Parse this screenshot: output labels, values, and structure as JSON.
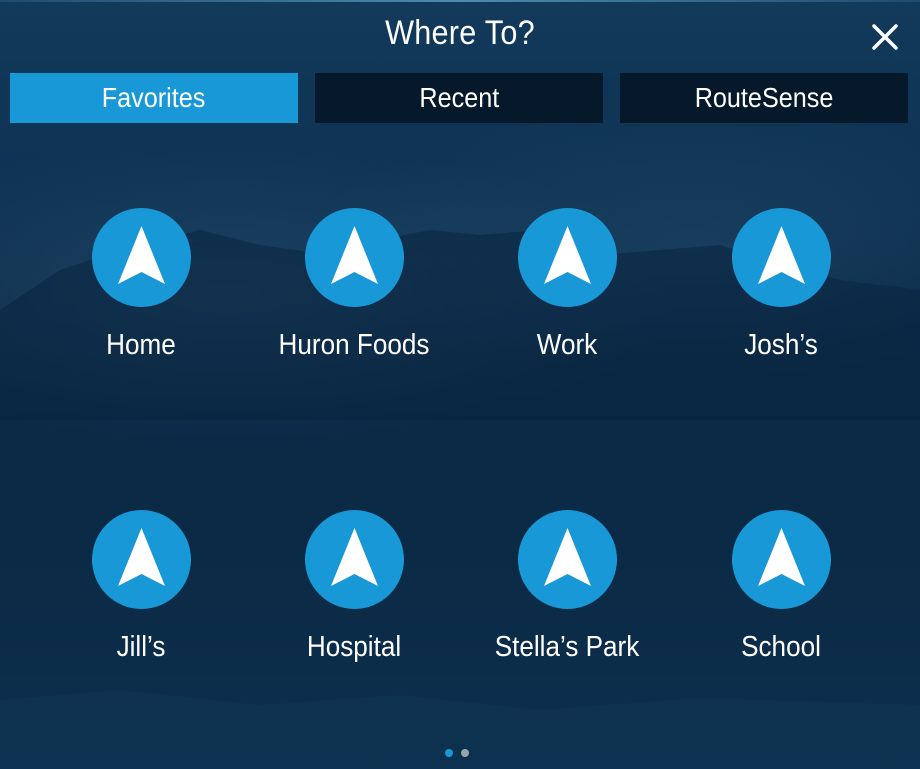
{
  "header": {
    "title": "Where To?",
    "close_icon": "close-icon"
  },
  "tabs": [
    {
      "label": "Favorites",
      "active": true
    },
    {
      "label": "Recent",
      "active": false
    },
    {
      "label": "RouteSense",
      "active": false
    }
  ],
  "favorites": [
    {
      "label": "Home",
      "icon": "navigation-arrow-icon"
    },
    {
      "label": "Huron Foods",
      "icon": "navigation-arrow-icon"
    },
    {
      "label": "Work",
      "icon": "navigation-arrow-icon"
    },
    {
      "label": "Josh’s",
      "icon": "navigation-arrow-icon"
    },
    {
      "label": "Jill’s",
      "icon": "navigation-arrow-icon"
    },
    {
      "label": "Hospital",
      "icon": "navigation-arrow-icon"
    },
    {
      "label": "Stella’s Park",
      "icon": "navigation-arrow-icon"
    },
    {
      "label": "School",
      "icon": "navigation-arrow-icon"
    }
  ],
  "pagination": {
    "pages": 2,
    "current": 1
  },
  "colors": {
    "accent": "#1898d6",
    "tab_inactive": "#06192b",
    "background": "#0b2a45",
    "dot_inactive": "#9aa4ad"
  }
}
